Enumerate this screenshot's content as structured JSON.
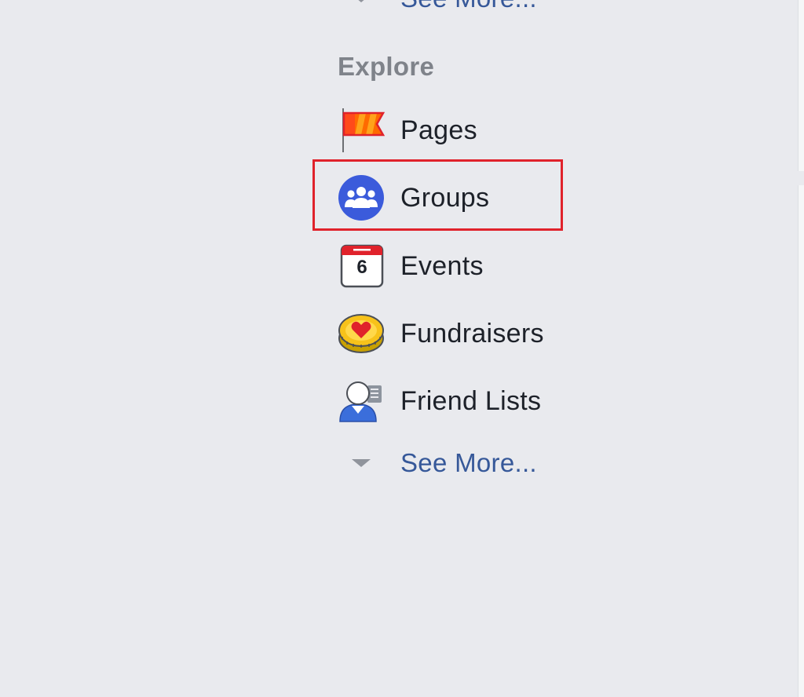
{
  "sidebar": {
    "top_see_more": "See More...",
    "explore": {
      "title": "Explore",
      "items": [
        {
          "label": "Pages",
          "icon": "flag-icon"
        },
        {
          "label": "Groups",
          "icon": "groups-icon",
          "highlighted": true
        },
        {
          "label": "Events",
          "icon": "calendar-icon",
          "calendar_day": "6"
        },
        {
          "label": "Fundraisers",
          "icon": "heart-coin-icon"
        },
        {
          "label": "Friend Lists",
          "icon": "friend-list-icon"
        }
      ],
      "see_more": "See More..."
    }
  },
  "colors": {
    "link": "#365899",
    "section_title": "#7f838a",
    "text": "#1d2129",
    "highlight": "#e0222b",
    "background": "#e9eaee",
    "groups_blue": "#3b5bdb"
  }
}
